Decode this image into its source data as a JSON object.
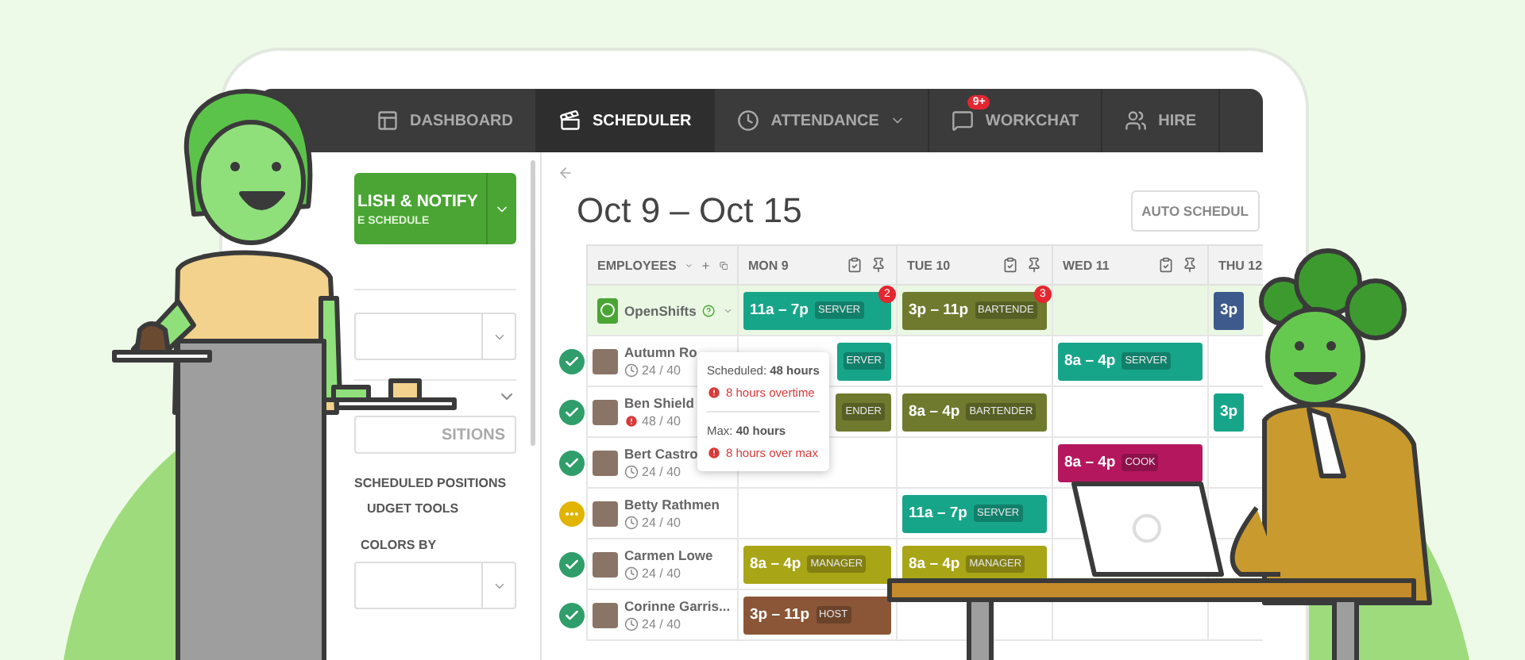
{
  "nav": {
    "items": [
      {
        "label": "DASHBOARD",
        "selected": false,
        "dropdown": false
      },
      {
        "label": "SCHEDULER",
        "selected": true,
        "dropdown": false
      },
      {
        "label": "ATTENDANCE",
        "selected": false,
        "dropdown": true
      },
      {
        "label": "WORKCHAT",
        "selected": false,
        "dropdown": false,
        "badge": "9+"
      },
      {
        "label": "HIRE",
        "selected": false,
        "dropdown": false
      }
    ]
  },
  "sidebar": {
    "publish_button": {
      "label": "LISH & NOTIFY",
      "sublabel": "E SCHEDULE"
    },
    "positions_button": "SITIONS",
    "options": [
      "SCHEDULED POSITIONS",
      "UDGET TOOLS"
    ],
    "colors_label": "COLORS BY"
  },
  "schedule": {
    "title": "Oct 9 – Oct 15",
    "auto_button": "AUTO SCHEDUL",
    "employees_header": "EMPLOYEES",
    "days": [
      "MON 9",
      "TUE 10",
      "WED 11",
      "THU 12"
    ],
    "open_shifts": {
      "label": "OpenShifts",
      "cells": [
        {
          "time": "11a – 7p",
          "role": "SERVER",
          "color": "#17a589",
          "badge": "2"
        },
        {
          "time": "3p – 11p",
          "role": "BARTENDE",
          "color": "#6f7a2f",
          "badge": "3"
        },
        null,
        {
          "time": "3p",
          "color": "#3e5a8c"
        }
      ]
    },
    "employees": [
      {
        "name": "Autumn Ro",
        "hours": "24 / 40",
        "confirmed": true,
        "alert": false,
        "cells": [
          {
            "role": "ERVER",
            "color": "#17a589"
          },
          null,
          {
            "time": "8a – 4p",
            "role": "SERVER",
            "color": "#17a589"
          },
          null
        ]
      },
      {
        "name": "Ben Shield",
        "hours": "48 / 40",
        "confirmed": true,
        "alert": true,
        "cells": [
          {
            "role": "ENDER",
            "color": "#6f7a2f"
          },
          {
            "time": "8a – 4p",
            "role": "BARTENDER",
            "color": "#6f7a2f"
          },
          null,
          {
            "time": "3p",
            "color": "#17a589"
          }
        ]
      },
      {
        "name": "Bert Castro",
        "hours": "24 / 40",
        "confirmed": true,
        "alert": false,
        "cells": [
          null,
          null,
          {
            "time": "8a – 4p",
            "role": "COOK",
            "color": "#b5175f"
          },
          null
        ]
      },
      {
        "name": "Betty Rathmen",
        "hours": "24 / 40",
        "confirmed": false,
        "alert": false,
        "cells": [
          null,
          {
            "time": "11a – 7p",
            "role": "SERVER",
            "color": "#17a589"
          },
          null,
          null
        ]
      },
      {
        "name": "Carmen Lowe",
        "hours": "24 / 40",
        "confirmed": true,
        "alert": false,
        "cells": [
          {
            "time": "8a – 4p",
            "role": "MANAGER",
            "color": "#a8a517"
          },
          {
            "time": "8a – 4p",
            "role": "MANAGER",
            "color": "#a8a517"
          },
          null,
          null
        ]
      },
      {
        "name": "Corinne Garris...",
        "hours": "24 / 40",
        "confirmed": true,
        "alert": false,
        "cells": [
          {
            "time": "3p – 11p",
            "role": "HOST",
            "color": "#8a5637"
          },
          null,
          null,
          null
        ]
      }
    ],
    "tooltip": {
      "scheduled": "Scheduled: **48 hours**",
      "overtime": "8 hours overtime",
      "max": "Max: **40 hours**",
      "over_max": "8 hours over max"
    }
  }
}
